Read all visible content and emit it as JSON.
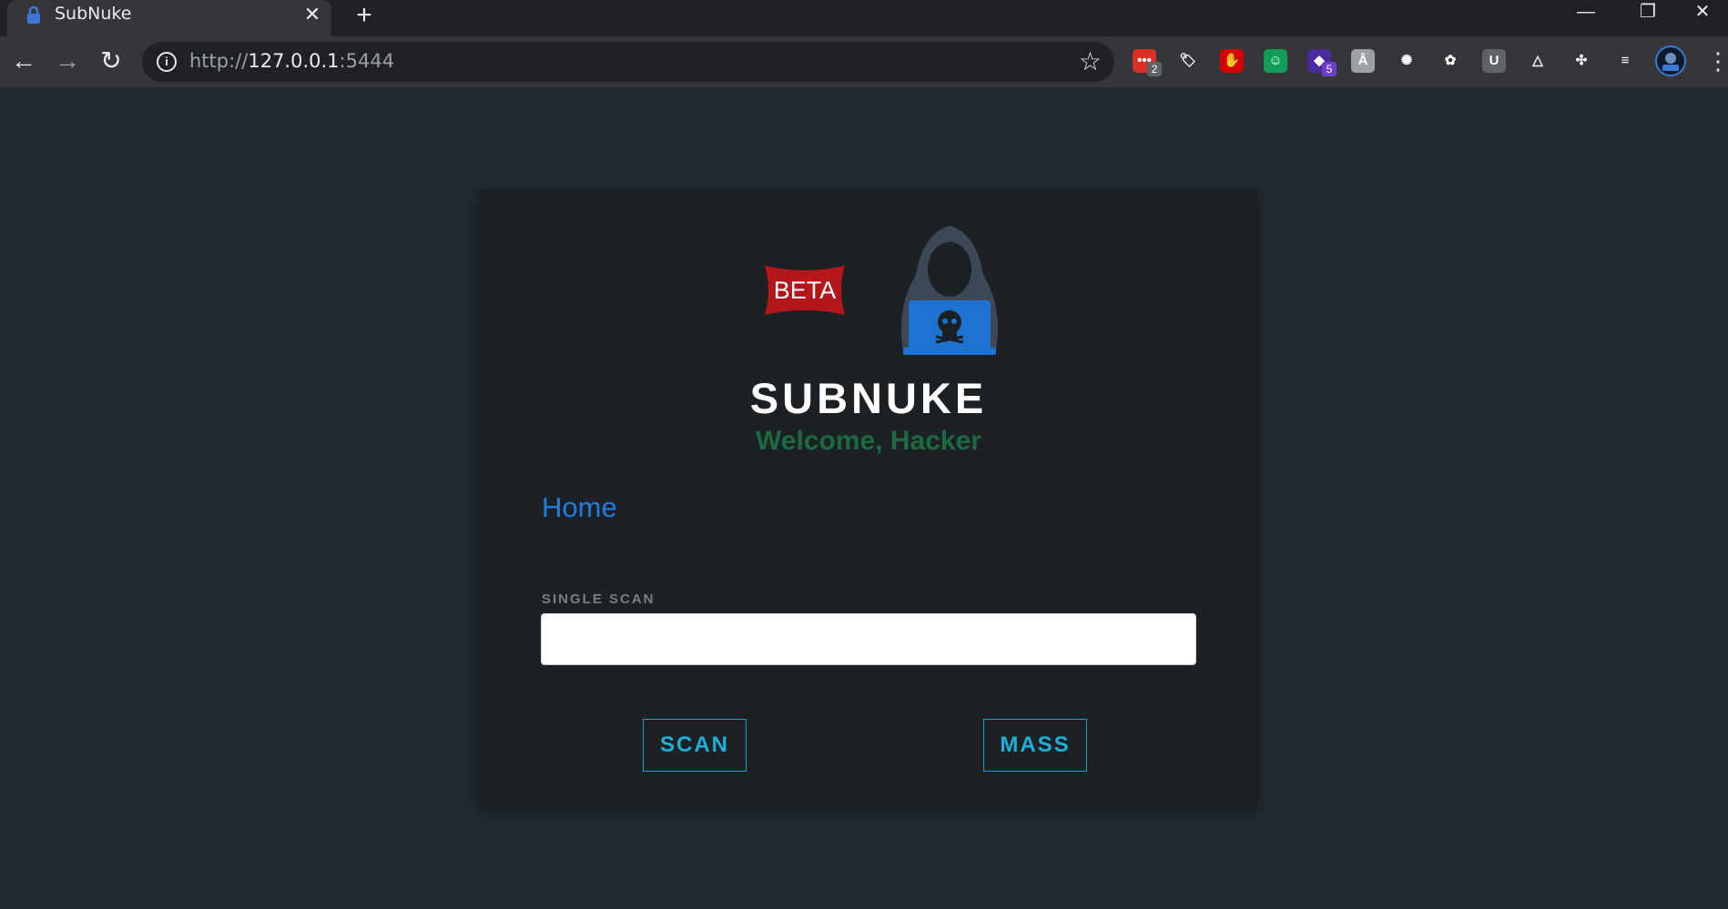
{
  "browser": {
    "tab_title": "SubNuke",
    "tab_close": "✕",
    "new_tab": "+",
    "url_scheme": "http://",
    "url_host": "127.0.0.1",
    "url_port": ":5444",
    "info_icon": "i",
    "back": "←",
    "forward": "→",
    "reload": "↻",
    "star": "☆",
    "minimize": "—",
    "maximize": "❐",
    "close": "✕",
    "extensions": [
      {
        "name": "ext-red-icon",
        "color": "#d93025",
        "glyph": "•••",
        "badge": "2",
        "badge_color": "#5f6368"
      },
      {
        "name": "ext-tag-icon",
        "color": "transparent",
        "glyph": "🏷"
      },
      {
        "name": "ext-stop-icon",
        "color": "#d50000",
        "glyph": "✋"
      },
      {
        "name": "ext-green-icon",
        "color": "#0f9d58",
        "glyph": "☺"
      },
      {
        "name": "ext-purple-icon",
        "color": "#4a2b9e",
        "glyph": "◆",
        "badge": "5",
        "badge_color": "#6a3fd0"
      },
      {
        "name": "ext-grey-icon",
        "color": "#9aa0a6",
        "glyph": "Å"
      },
      {
        "name": "ext-blue-sun-icon",
        "color": "transparent",
        "glyph": "✺"
      },
      {
        "name": "ext-green-yellow-icon",
        "color": "transparent",
        "glyph": "✿"
      },
      {
        "name": "ext-u-icon",
        "color": "#5f6368",
        "glyph": "U"
      },
      {
        "name": "ext-triangle-icon",
        "color": "transparent",
        "glyph": "△"
      },
      {
        "name": "puzzle-icon",
        "color": "transparent",
        "glyph": "✣"
      },
      {
        "name": "media-queue-icon",
        "color": "transparent",
        "glyph": "≡"
      }
    ]
  },
  "app": {
    "beta": "BETA",
    "title": "SUBNUKE",
    "subtitle": "Welcome, Hacker",
    "home_link": "Home",
    "single_scan_label": "SINGLE SCAN",
    "scan_input_value": "",
    "scan_button": "SCAN",
    "mass_button": "MASS"
  },
  "colors": {
    "page_bg": "#222b31",
    "card_bg": "#1c2126",
    "accent": "#20b0d6",
    "subtitle": "#1d6a41",
    "link": "#1f7ce0"
  }
}
